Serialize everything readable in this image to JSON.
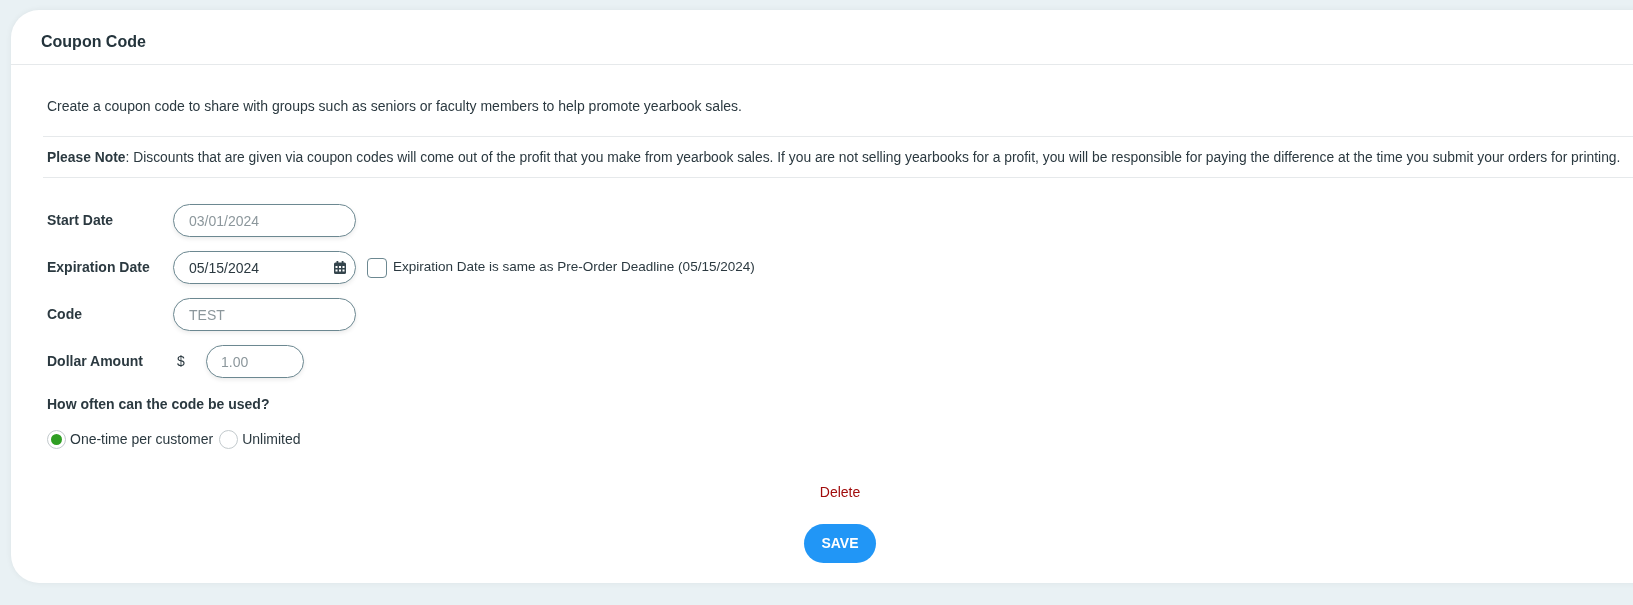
{
  "card": {
    "title": "Coupon Code"
  },
  "intro": "Create a coupon code to share with groups such as seniors or faculty members to help promote yearbook sales.",
  "note": "**Please Note**: Discounts that are given via coupon codes will come out of the profit that you make from yearbook sales. If you are not selling yearbooks for a profit, you will be responsible for paying the difference at the time you submit your orders for printing.",
  "fields": [
    {
      "kind": "text",
      "label": "Start Date",
      "value": "03/01/2024",
      "disabled": true
    },
    {
      "kind": "date_picker",
      "label": "Expiration Date",
      "value": "05/15/2024",
      "disabled": false,
      "checkbox": {
        "label": "Expiration Date is same as Pre-Order Deadline (05/15/2024)",
        "checked": false
      }
    },
    {
      "kind": "text",
      "label": "Code",
      "value": "TEST",
      "disabled": true
    },
    {
      "kind": "currency",
      "label": "Dollar Amount",
      "prefix": "$",
      "value": "1.00",
      "disabled": true
    }
  ],
  "usage": {
    "question": "How often can the code be used?",
    "options": [
      {
        "label": "One-time per customer",
        "selected": true
      },
      {
        "label": "Unlimited",
        "selected": false
      }
    ]
  },
  "actions": {
    "delete": "Delete",
    "save": "SAVE"
  }
}
